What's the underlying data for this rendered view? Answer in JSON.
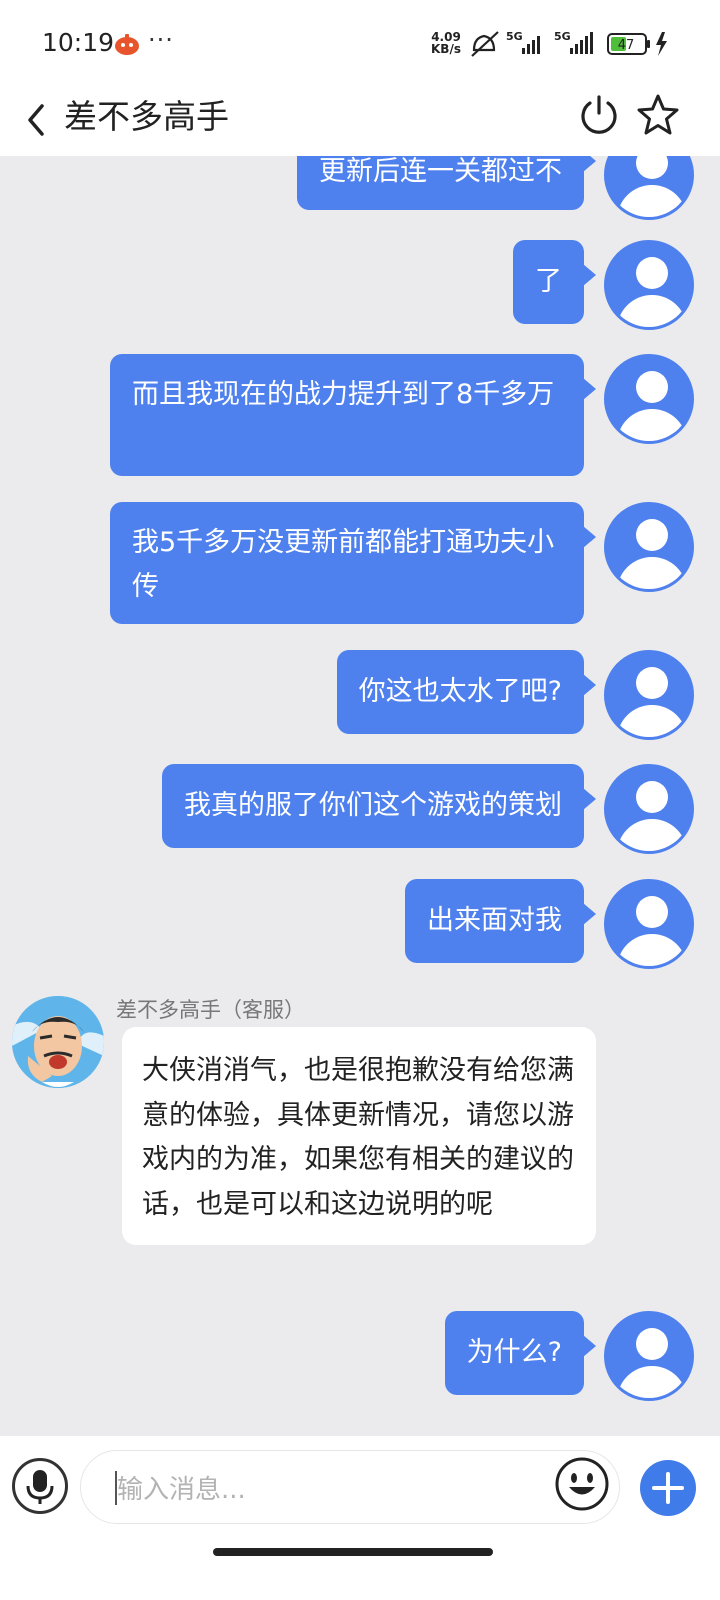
{
  "status_bar": {
    "time": "10:19",
    "more": "···",
    "speed_value": "4.09",
    "speed_unit": "KB/s",
    "battery": "47",
    "network_1": "5G",
    "network_2": "5G"
  },
  "header": {
    "title": "差不多高手",
    "back_icon": "chevron-left-icon",
    "power_icon": "power-icon",
    "star_icon": "star-icon"
  },
  "messages": [
    {
      "from": "user",
      "text": "更新后连一关都过不"
    },
    {
      "from": "user",
      "text": "了"
    },
    {
      "from": "user",
      "text": "而且我现在的战力提升到了8千多万"
    },
    {
      "from": "user",
      "text": "我5千多万没更新前都能打通功夫小传"
    },
    {
      "from": "user",
      "text": "你这也太水了吧?"
    },
    {
      "from": "user",
      "text": "我真的服了你们这个游戏的策划"
    },
    {
      "from": "user",
      "text": "出来面对我"
    },
    {
      "from": "agent",
      "name": "差不多高手（客服）",
      "text": "大侠消消气，也是很抱歉没有给您满意的体验，具体更新情况，请您以游戏内的为准，如果您有相关的建议的话，也是可以和这边说明的呢"
    },
    {
      "from": "user",
      "text": "为什么?"
    }
  ],
  "input": {
    "placeholder": "输入消息..."
  },
  "colors": {
    "user_bubble": "#4f81ee",
    "chat_background": "#ebebed",
    "plus_button": "#3f7be9"
  }
}
